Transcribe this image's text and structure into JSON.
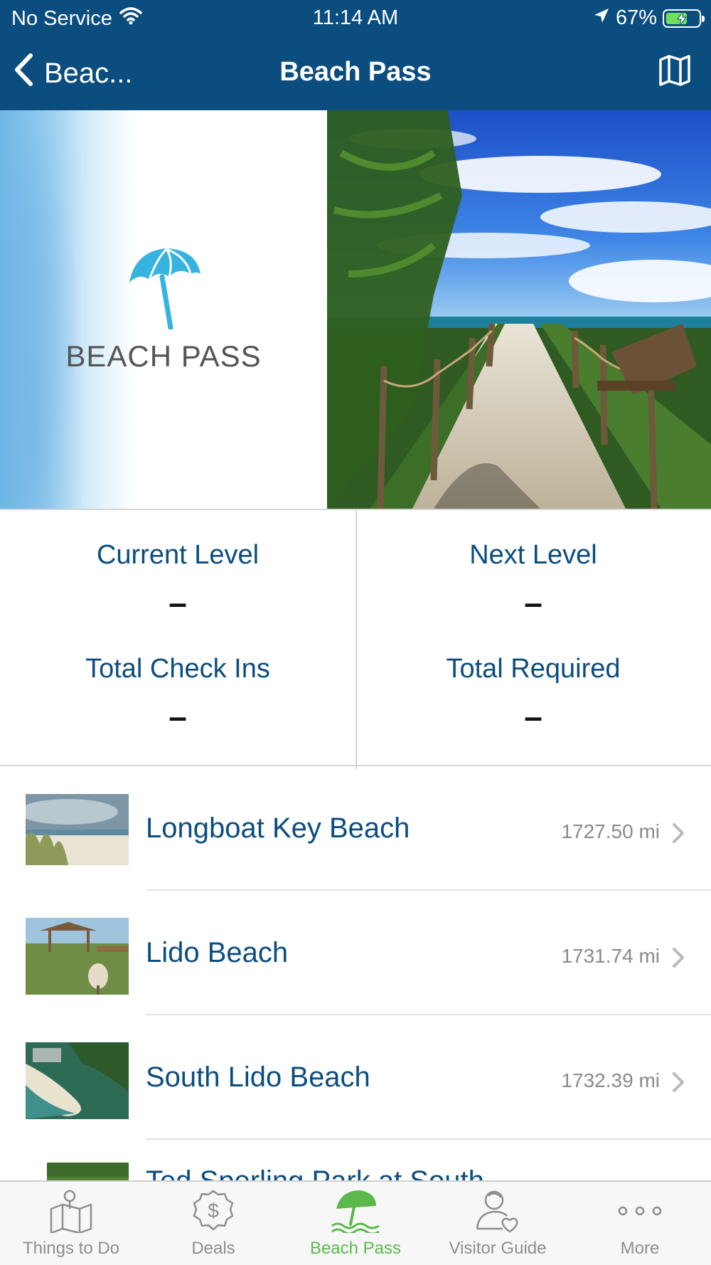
{
  "status_bar": {
    "carrier": "No Service",
    "time": "11:14 AM",
    "battery": "67%",
    "battery_level": 0.67
  },
  "nav": {
    "back_label": "Beac...",
    "title": "Beach Pass",
    "right_icon": "map-icon"
  },
  "hero": {
    "logo_text": "BEACH PASS",
    "logo_icon": "umbrella-icon",
    "accent": "#36b3df"
  },
  "stats": {
    "current_level_label": "Current Level",
    "current_level_value": "–",
    "next_level_label": "Next Level",
    "next_level_value": "–",
    "total_checkins_label": "Total Check Ins",
    "total_checkins_value": "–",
    "total_required_label": "Total Required",
    "total_required_value": "–"
  },
  "beaches": [
    {
      "name": "Longboat Key Beach",
      "distance": "1727.50 mi"
    },
    {
      "name": "Lido Beach",
      "distance": "1731.74 mi"
    },
    {
      "name": "South Lido Beach",
      "distance": "1732.39 mi"
    },
    {
      "name": "Ted Sperling Park at South",
      "distance": ""
    }
  ],
  "tabs": [
    {
      "label": "Things to Do",
      "icon": "map-pin-icon",
      "active": false
    },
    {
      "label": "Deals",
      "icon": "dollar-badge-icon",
      "active": false
    },
    {
      "label": "Beach Pass",
      "icon": "beach-umbrella-icon",
      "active": true
    },
    {
      "label": "Visitor Guide",
      "icon": "person-heart-icon",
      "active": false
    },
    {
      "label": "More",
      "icon": "more-dots-icon",
      "active": false
    }
  ],
  "colors": {
    "nav_bg": "#0b4d7f",
    "primary_text": "#0b4d7f",
    "active_tab": "#5cb84a",
    "inactive_tab": "#8e8e8e"
  }
}
